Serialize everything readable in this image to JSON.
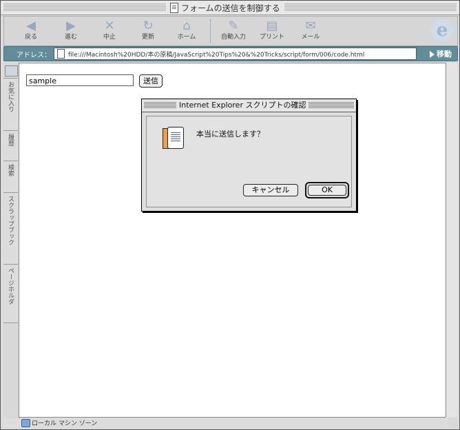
{
  "window": {
    "title": "フォームの送信を制御する"
  },
  "toolbar": {
    "buttons": [
      {
        "label": "戻る",
        "icon": "back-arrow-icon"
      },
      {
        "label": "進む",
        "icon": "forward-arrow-icon"
      },
      {
        "label": "中止",
        "icon": "stop-icon"
      },
      {
        "label": "更新",
        "icon": "refresh-icon"
      },
      {
        "label": "ホーム",
        "icon": "home-icon"
      },
      {
        "label": "自動入力",
        "icon": "autofill-icon"
      },
      {
        "label": "プリント",
        "icon": "print-icon"
      },
      {
        "label": "メール",
        "icon": "mail-icon"
      }
    ]
  },
  "address_bar": {
    "label": "アドレス：",
    "url": "file:///Macintosh%20HDD/本の原稿/JavaScript%20Tips%20&%20Tricks/script/form/006/code.html",
    "go_label": "移動"
  },
  "sidebar": {
    "tabs": [
      "お気に入り",
      "履歴",
      "検索",
      "スクラップブック",
      "ページホルダ"
    ]
  },
  "page": {
    "text_input_value": "sample",
    "submit_label": "送信"
  },
  "dialog": {
    "title": "Internet Explorer スクリプトの確認",
    "message": "本当に送信します？",
    "cancel_label": "キャンセル",
    "ok_label": "OK"
  },
  "status_bar": {
    "zone": "ローカル マシン ゾーン"
  }
}
